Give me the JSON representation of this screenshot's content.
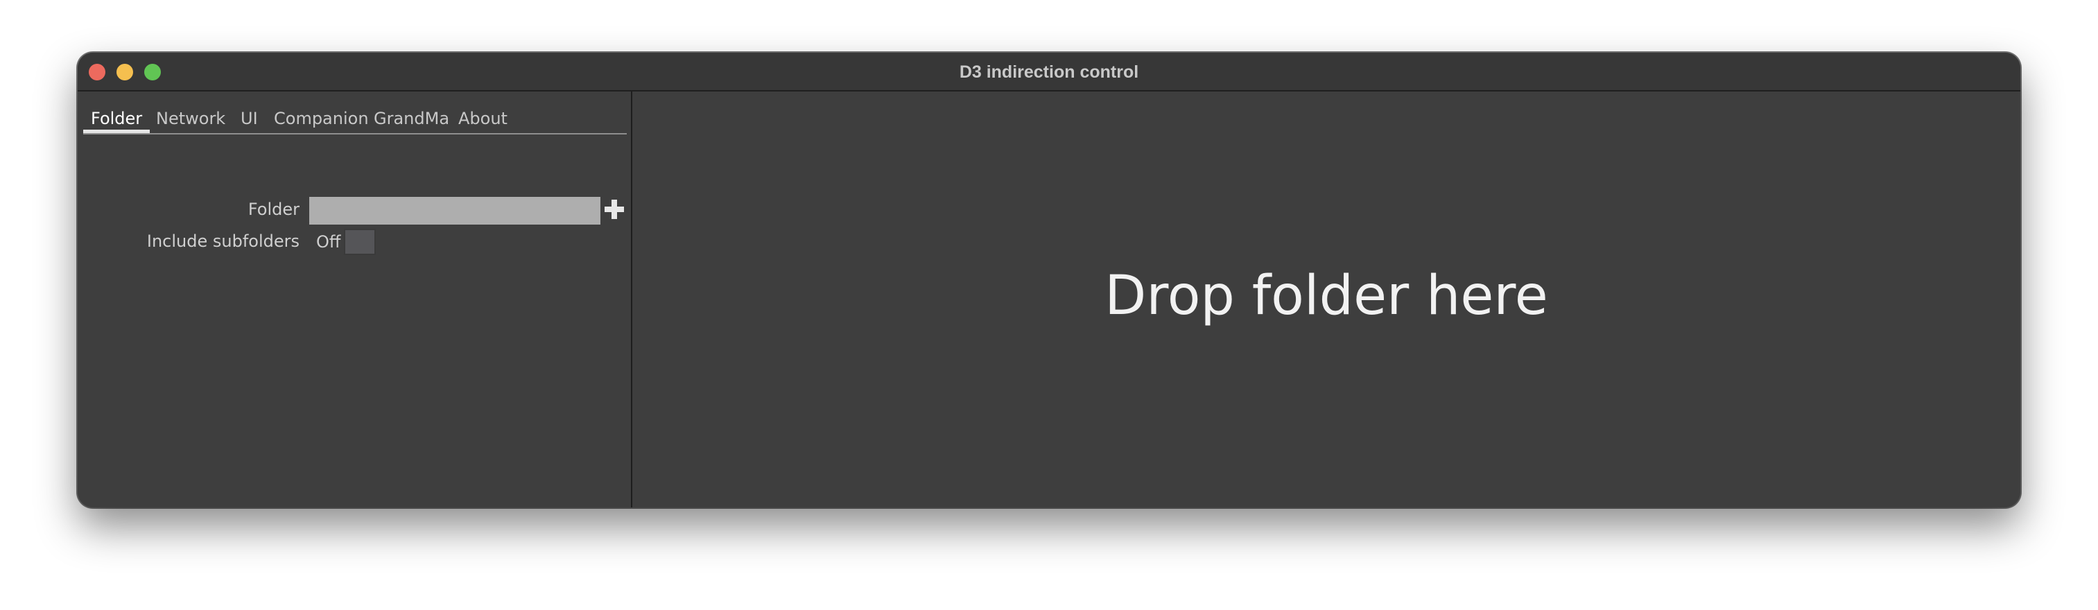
{
  "window": {
    "title": "D3 indirection control"
  },
  "tabs": [
    {
      "label": "Folder",
      "active": true
    },
    {
      "label": "Network",
      "active": false
    },
    {
      "label": "UI",
      "active": false
    },
    {
      "label": "Companion",
      "active": false
    },
    {
      "label": "GrandMa",
      "active": false
    },
    {
      "label": "About",
      "active": false
    }
  ],
  "folder_tab": {
    "folder_label": "Folder",
    "folder_value": "",
    "add_icon": "plus-icon",
    "subfolders_label": "Include subfolders",
    "subfolders_state": "Off"
  },
  "main": {
    "drop_text": "Drop folder here"
  },
  "colors": {
    "window_bg": "#3e3e3e",
    "input_bg": "#aeaeae",
    "close": "#ed6a5e",
    "minimize": "#f5bf4f",
    "maximize": "#61c554"
  }
}
